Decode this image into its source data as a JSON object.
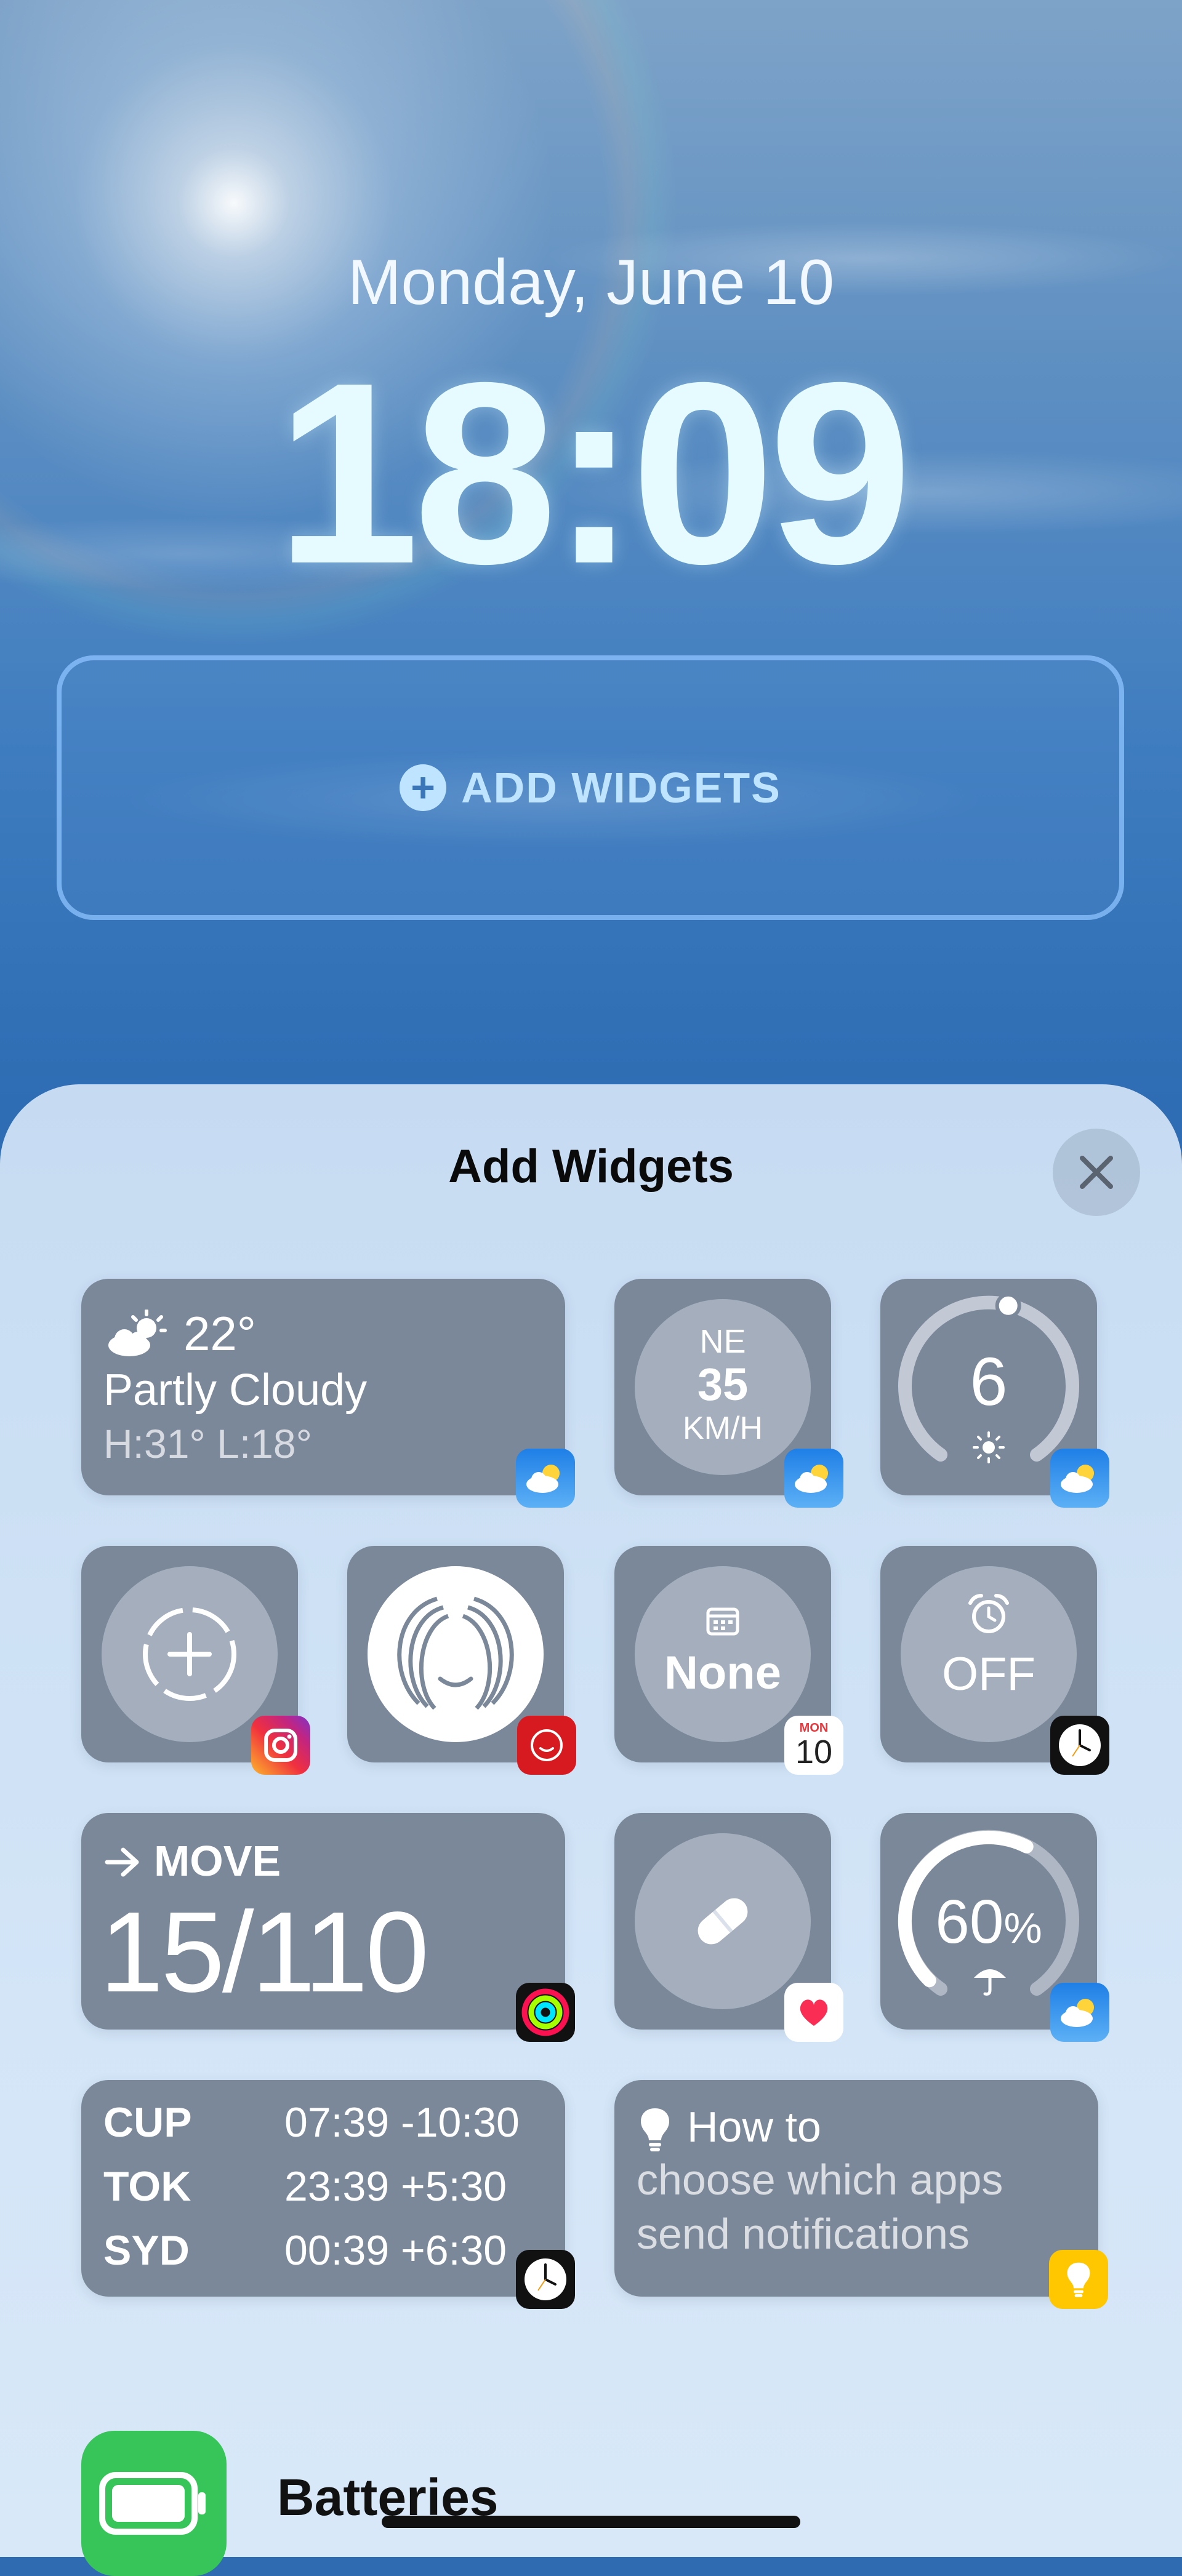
{
  "lock_screen": {
    "date": "Monday, June 10",
    "time": "18:09",
    "add_widgets_zone_label": "ADD WIDGETS"
  },
  "sheet": {
    "title": "Add Widgets",
    "close_icon": "close-icon"
  },
  "widgets": {
    "weather_conditions": {
      "icon": "partly-cloudy-icon",
      "temperature": "22°",
      "condition": "Partly Cloudy",
      "high_low": "H:31° L:18°",
      "app": "Weather"
    },
    "wind": {
      "direction": "NE",
      "speed": "35",
      "unit": "KM/H",
      "app": "Weather"
    },
    "uv_index": {
      "value": "6",
      "level_fraction": 0.55,
      "icon": "sun-icon",
      "app": "Weather"
    },
    "instagram_add": {
      "icon": "dashed-plus-icon",
      "app": "Instagram"
    },
    "ai_app": {
      "icon": "face-logo-icon",
      "app": "Red AI app"
    },
    "calendar_next_event": {
      "icon": "calendar-icon",
      "value": "None",
      "app_badge_day": "MON",
      "app_badge_date": "10"
    },
    "alarm": {
      "icon": "alarm-clock-icon",
      "value": "OFF",
      "app": "Clock"
    },
    "activity_move": {
      "icon": "arrow-right-icon",
      "label": "MOVE",
      "value": "15/110",
      "app": "Fitness"
    },
    "medications": {
      "icon": "pill-icon",
      "app": "Health"
    },
    "rain_chance": {
      "value": "60",
      "unit": "%",
      "level_fraction": 0.6,
      "icon": "umbrella-icon",
      "app": "Weather"
    },
    "world_clock": {
      "rows": [
        {
          "city": "CUP",
          "time": "07:39 -10:30"
        },
        {
          "city": "TOK",
          "time": "23:39 +5:30"
        },
        {
          "city": "SYD",
          "time": "00:39 +6:30"
        }
      ],
      "app": "Clock"
    },
    "tips": {
      "icon": "lightbulb-icon",
      "title": "How to",
      "body": "choose which apps send notifications",
      "app": "Tips"
    }
  },
  "app_list": {
    "first_item": "Batteries",
    "first_item_icon": "battery-icon"
  },
  "colors": {
    "tile": "#7b8899",
    "sheet": "#c6daf1",
    "batteries_green": "#37c459"
  }
}
